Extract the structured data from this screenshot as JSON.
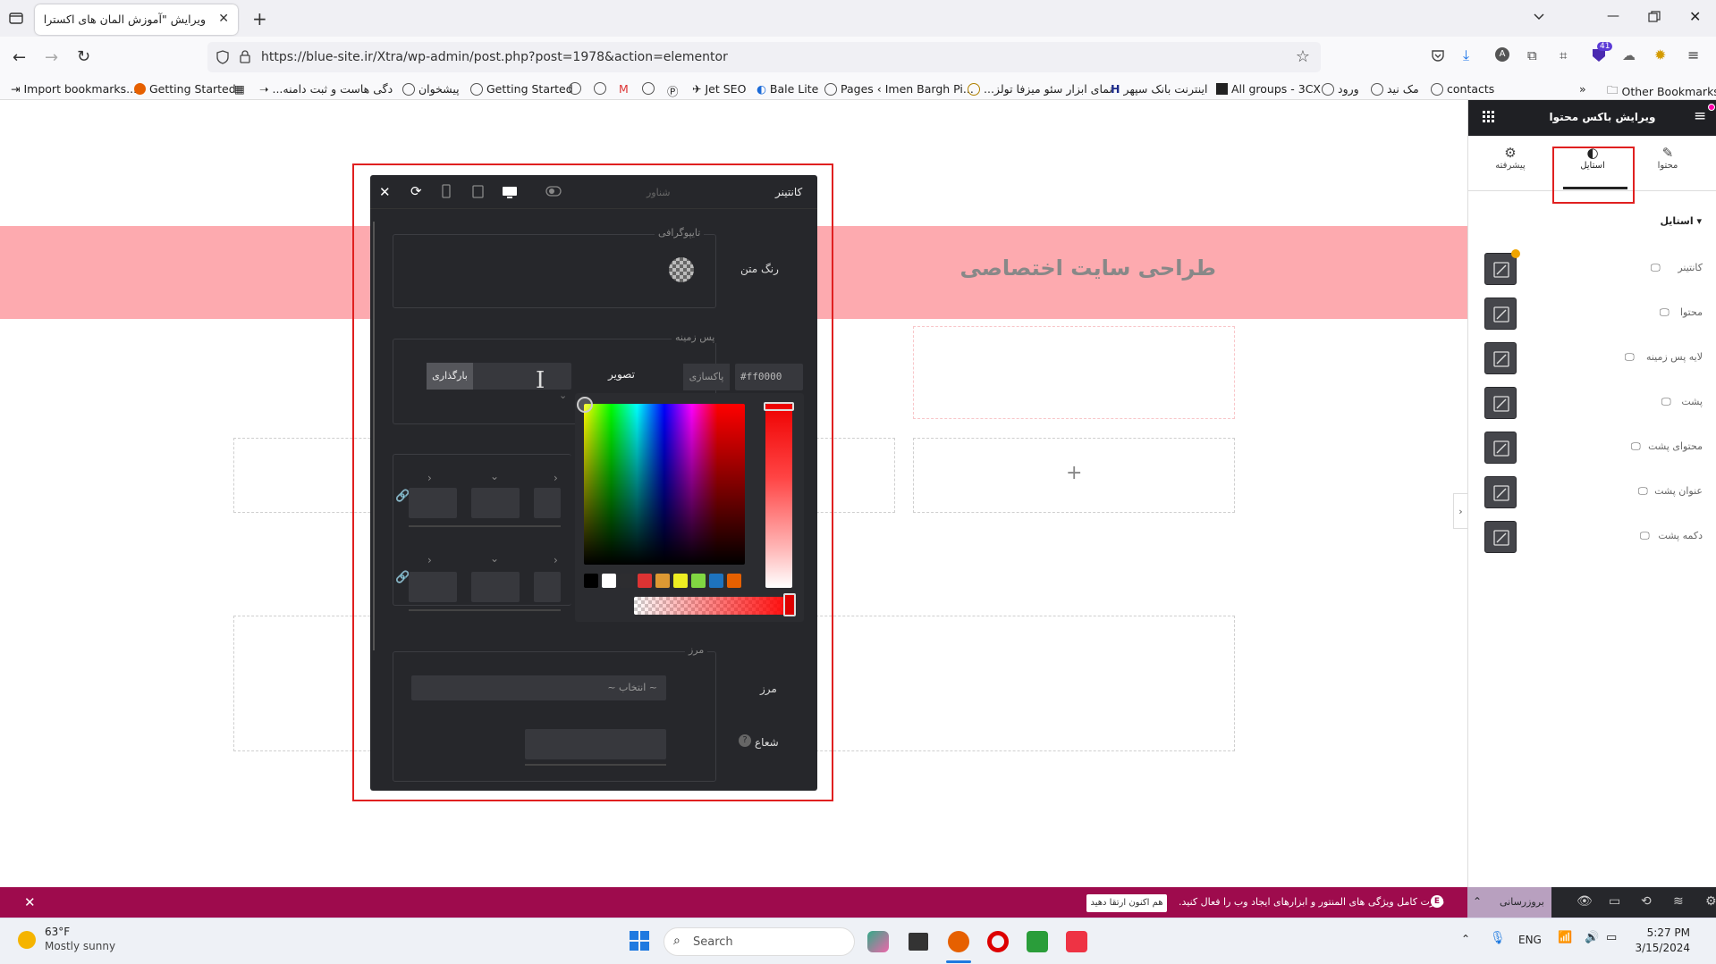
{
  "browser": {
    "tab_title": "ویرایش \"آموزش المان های اکسترا – ما",
    "url": "https://blue-site.ir/Xtra/wp-admin/post.php?post=1978&action=elementor",
    "notif_count": "41",
    "bookmarks": [
      "Import bookmarks...",
      "Getting Started",
      "...دگی هاست و ثبت دامنه",
      "پیشخوان",
      "Getting Started",
      "Jet SEO",
      "Bale Lite",
      "Pages ‹ Imen Bargh Pi...",
      "...نمای ابزار سئو میزفا تولز",
      "اینترنت بانک سپهر",
      "All groups - 3CX",
      "ورود",
      "مک نید",
      "contacts"
    ],
    "other_bookmarks": "Other Bookmarks"
  },
  "page": {
    "banner_title": "طراحی سایت اختصاصی",
    "plus": "+"
  },
  "popover": {
    "tab_container": "کانتینر",
    "tab_floating": "شناور",
    "typography_title": "تایپوگرافی",
    "text_color_label": "رنگ متن",
    "background_title": "پس زمینه",
    "hex_value": "#ff0000",
    "clear_label": "پاکسازی",
    "image_label": "تصویر",
    "upload_label": "بارگذاری",
    "border_title": "مرز",
    "border_label": "مرز",
    "border_select": "~ انتخاب ~",
    "radius_label": "شعاع"
  },
  "panel": {
    "title": "ویرایش باکس محتوا",
    "tabs": [
      "محتوا",
      "استایل",
      "پیشرفته"
    ],
    "active_tab": "استایل",
    "section_title": "استایل",
    "rows": [
      "کانتینر",
      "محتوا",
      "لایه پس زمینه",
      "پشت",
      "محتوای پشت",
      "عنوان پشت",
      "دکمه پشت"
    ]
  },
  "notice": {
    "text": "قدرت کامل ویژگی های المنتور و ابزارهای ایجاد وب را فعال کنید.",
    "cta": "هم اکنون ارتقا دهید"
  },
  "editor_bar": {
    "update_label": "بروزرسانی"
  },
  "taskbar": {
    "weather_temp": "63°F",
    "weather_desc": "Mostly sunny",
    "search_placeholder": "Search",
    "lang": "ENG",
    "time": "5:27 PM",
    "date": "3/15/2024"
  },
  "colors": {
    "accent_red": "#e02020",
    "pink_banner": "#fdaaaf",
    "notice_bg": "#9e0b4d",
    "panel_dark": "#26272b"
  }
}
